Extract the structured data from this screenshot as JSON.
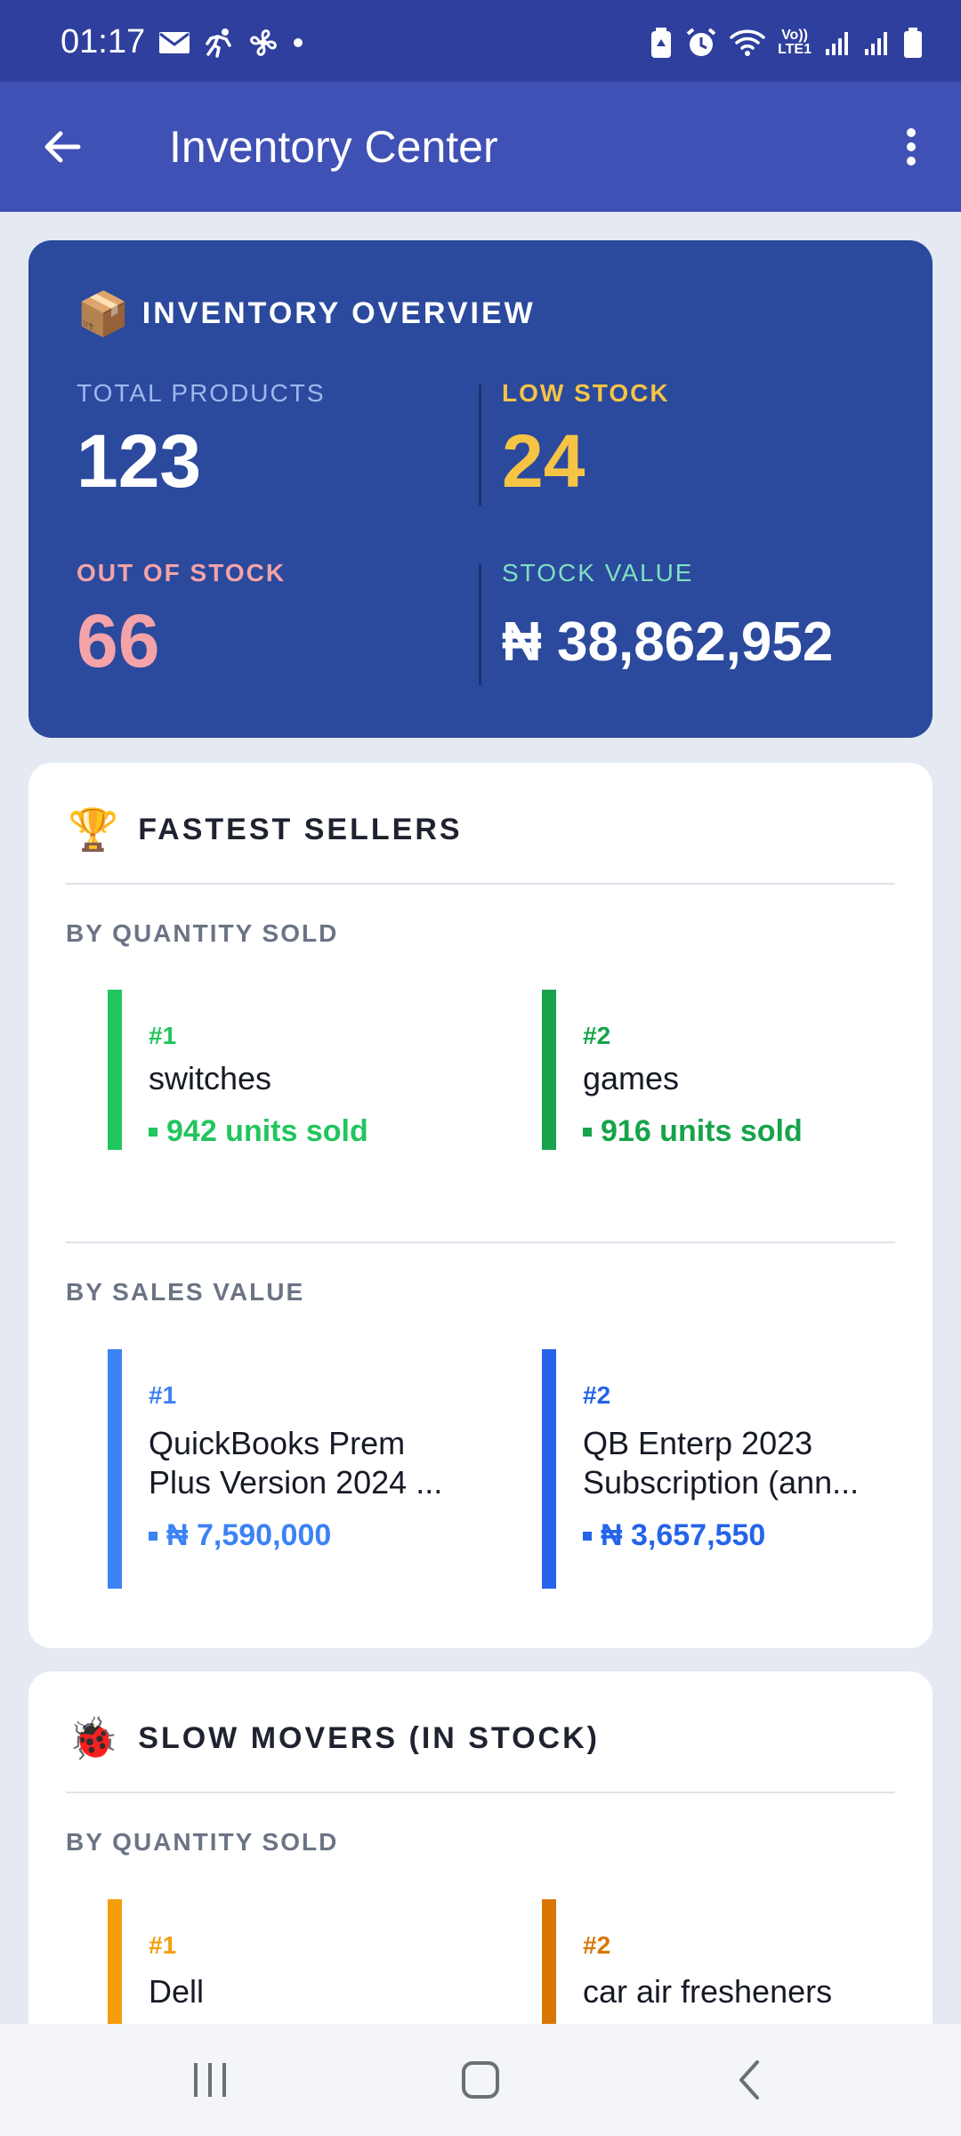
{
  "status_bar": {
    "time": "01:17",
    "net_top": "Vo))",
    "net_bottom": "LTE1"
  },
  "app_bar": {
    "title": "Inventory Center"
  },
  "overview": {
    "icon": "📦",
    "title": "INVENTORY OVERVIEW",
    "total_products": {
      "label": "TOTAL PRODUCTS",
      "value": "123"
    },
    "low_stock": {
      "label": "LOW STOCK",
      "value": "24"
    },
    "out_of_stock": {
      "label": "OUT OF STOCK",
      "value": "66"
    },
    "stock_value": {
      "label": "STOCK VALUE",
      "value": "₦ 38,862,952"
    }
  },
  "fastest": {
    "icon": "🏆",
    "title": "FASTEST SELLERS",
    "by_qty_label": "BY QUANTITY SOLD",
    "by_qty": [
      {
        "rank": "#1",
        "name": "switches",
        "metric": "942 units sold"
      },
      {
        "rank": "#2",
        "name": "games",
        "metric": "916 units sold"
      }
    ],
    "by_value_label": "BY SALES VALUE",
    "by_value": [
      {
        "rank": "#1",
        "name": "QuickBooks Prem Plus Version 2024 ...",
        "metric": "₦ 7,590,000"
      },
      {
        "rank": "#2",
        "name": "QB Enterp 2023 Subscription (ann...",
        "metric": "₦ 3,657,550"
      }
    ]
  },
  "slow": {
    "icon": "🐞",
    "title": "SLOW MOVERS (IN STOCK)",
    "by_qty_label": "BY QUANTITY SOLD",
    "by_qty": [
      {
        "rank": "#1",
        "name": "Dell"
      },
      {
        "rank": "#2",
        "name": "car air fresheners"
      }
    ]
  },
  "colors": {
    "status_bar": "#2f3f9e",
    "app_bar": "#3f51b5",
    "overview_bg": "#2b4a9d",
    "low_stock": "#f6c445",
    "out_of_stock": "#f4a3a8",
    "stock_value_label": "#7fe0c0",
    "total_label": "#9fb8f0",
    "green_1": "#22c55e",
    "green_2": "#16a34a",
    "blue_1": "#3b82f6",
    "blue_2": "#2563eb",
    "orange_1": "#f59e0b",
    "orange_2": "#d97706"
  }
}
